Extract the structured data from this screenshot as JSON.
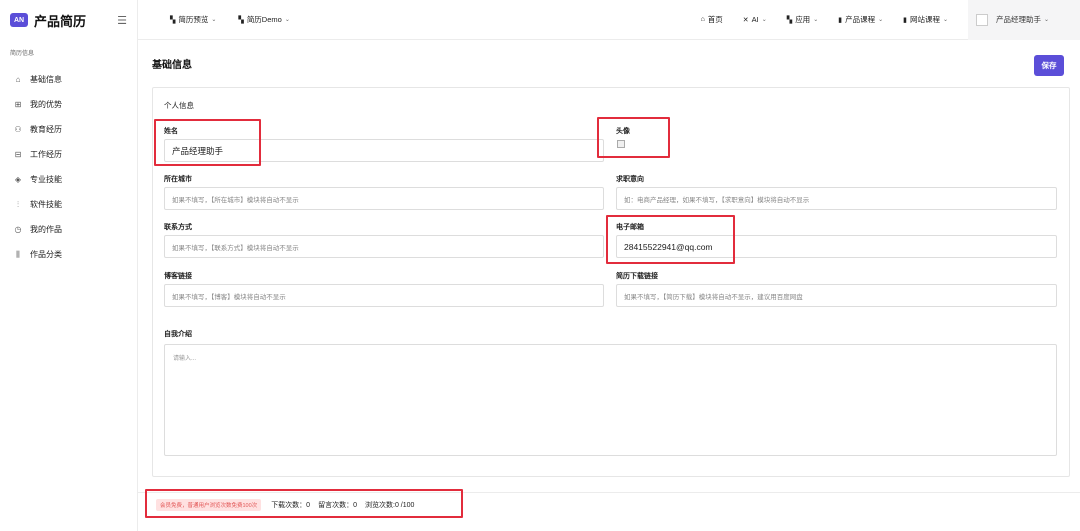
{
  "app": {
    "logo_mark": "AN",
    "name": "产品简历"
  },
  "sidebar": {
    "section": "简历信息",
    "items": [
      {
        "label": "基础信息",
        "icon": "home-icon"
      },
      {
        "label": "我的优势",
        "icon": "grid-icon"
      },
      {
        "label": "教育经历",
        "icon": "users-icon"
      },
      {
        "label": "工作经历",
        "icon": "gift-icon"
      },
      {
        "label": "专业技能",
        "icon": "cube-icon"
      },
      {
        "label": "软件技能",
        "icon": "sliders-icon"
      },
      {
        "label": "我的作品",
        "icon": "clock-icon"
      },
      {
        "label": "作品分类",
        "icon": "columns-icon"
      }
    ]
  },
  "topbar": {
    "left": [
      {
        "label": "简历预览"
      },
      {
        "label": "简历Demo"
      }
    ],
    "right": [
      {
        "label": "首页"
      },
      {
        "label": "AI"
      },
      {
        "label": "应用"
      },
      {
        "label": "产品课程"
      },
      {
        "label": "网站课程"
      }
    ],
    "user": "产品经理助手"
  },
  "main": {
    "title": "基础信息",
    "save_label": "保存",
    "section_title": "个人信息",
    "fields": {
      "name": {
        "label": "姓名",
        "value": "产品经理助手"
      },
      "avatar": {
        "label": "头像"
      },
      "city": {
        "label": "所在城市",
        "placeholder": "如果不填写，【所在城市】模块将自动不显示"
      },
      "job": {
        "label": "求职意向",
        "placeholder": "如：电商产品经理，如果不填写，【求职意向】模块将自动不显示"
      },
      "contact": {
        "label": "联系方式",
        "placeholder": "如果不填写，【联系方式】模块将自动不显示"
      },
      "email": {
        "label": "电子邮箱",
        "value": "28415522941@qq.com"
      },
      "blog": {
        "label": "博客链接",
        "placeholder": "如果不填写，【博客】模块将自动不显示"
      },
      "resume": {
        "label": "简历下载链接",
        "placeholder": "如果不填写，【简历下载】模块将自动不显示，建议用百度网盘"
      },
      "intro": {
        "label": "自我介绍",
        "placeholder": "请输入..."
      }
    }
  },
  "footer": {
    "badge": "会员免费，普通用户浏览次数免费100次",
    "downloads": "下载次数：0",
    "messages": "留言次数：0",
    "views": "浏览次数:0 /100"
  },
  "colors": {
    "accent": "#5b4ed8",
    "highlight": "#e22c3c"
  }
}
